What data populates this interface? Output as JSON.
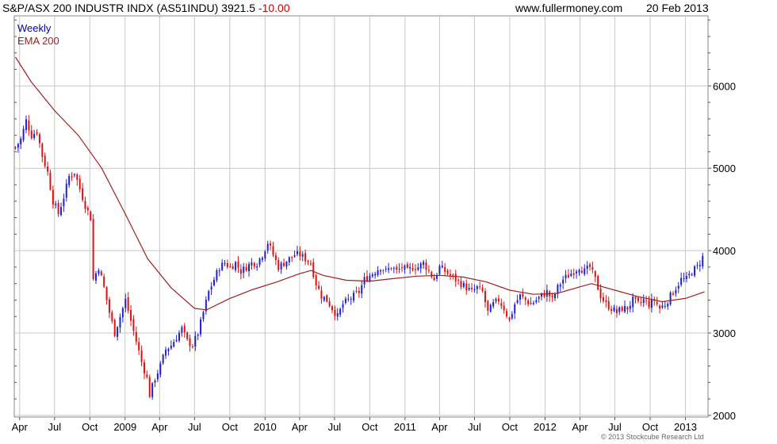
{
  "header": {
    "title_main": "S&P/ASX 200 INDUSTR INDX (AS51INDU) 3921.5",
    "title_change": "-10.00",
    "site": "www.fullermoney.com",
    "date": "20 Feb 2013"
  },
  "copyright": "© 2013 Stockcube Research Ltd",
  "colors": {
    "up": "#1f1fd6",
    "down": "#e01010",
    "ema": "#a02020",
    "grid": "#c8c8c8",
    "weekly_label": "#0000aa",
    "ema_label": "#a02020"
  },
  "chart_data": {
    "type": "candlestick",
    "title": "S&P/ASX 200 INDUSTR INDX (AS51INDU) 3921.5 -10.00",
    "legend": [
      "Weekly",
      "EMA 200"
    ],
    "legend_position": "top-left",
    "grid": true,
    "ylim": [
      1980,
      6850
    ],
    "yticks": [
      2000,
      3000,
      4000,
      5000,
      6000
    ],
    "xlim": [
      "2008-03-18",
      "2013-03-01"
    ],
    "xticks": [
      {
        "label": "Apr",
        "date": "2008-04-01"
      },
      {
        "label": "Jul",
        "date": "2008-07-01"
      },
      {
        "label": "Oct",
        "date": "2008-10-01"
      },
      {
        "label": "2009",
        "date": "2009-01-01"
      },
      {
        "label": "Apr",
        "date": "2009-04-01"
      },
      {
        "label": "Jul",
        "date": "2009-07-01"
      },
      {
        "label": "Oct",
        "date": "2009-10-01"
      },
      {
        "label": "2010",
        "date": "2010-01-01"
      },
      {
        "label": "Apr",
        "date": "2010-04-01"
      },
      {
        "label": "Jul",
        "date": "2010-07-01"
      },
      {
        "label": "Oct",
        "date": "2010-10-01"
      },
      {
        "label": "2011",
        "date": "2011-01-01"
      },
      {
        "label": "Apr",
        "date": "2011-04-01"
      },
      {
        "label": "Jul",
        "date": "2011-07-01"
      },
      {
        "label": "Oct",
        "date": "2011-10-01"
      },
      {
        "label": "2012",
        "date": "2012-01-01"
      },
      {
        "label": "Apr",
        "date": "2012-04-01"
      },
      {
        "label": "Jul",
        "date": "2012-07-01"
      },
      {
        "label": "Oct",
        "date": "2012-10-01"
      },
      {
        "label": "2013",
        "date": "2013-01-01"
      }
    ],
    "close_path": [
      [
        "2008-03-21",
        5250
      ],
      [
        "2008-04-04",
        5350
      ],
      [
        "2008-04-18",
        5580
      ],
      [
        "2008-05-02",
        5400
      ],
      [
        "2008-05-16",
        5450
      ],
      [
        "2008-05-30",
        5150
      ],
      [
        "2008-06-13",
        4950
      ],
      [
        "2008-06-27",
        4600
      ],
      [
        "2008-07-11",
        4450
      ],
      [
        "2008-07-25",
        4650
      ],
      [
        "2008-08-08",
        4900
      ],
      [
        "2008-08-22",
        4950
      ],
      [
        "2008-09-05",
        4750
      ],
      [
        "2008-09-19",
        4550
      ],
      [
        "2008-10-03",
        4400
      ],
      [
        "2008-10-10",
        3650
      ],
      [
        "2008-10-24",
        3800
      ],
      [
        "2008-11-07",
        3550
      ],
      [
        "2008-11-21",
        3250
      ],
      [
        "2008-12-05",
        3000
      ],
      [
        "2008-12-19",
        3200
      ],
      [
        "2009-01-02",
        3400
      ],
      [
        "2009-01-16",
        3150
      ],
      [
        "2009-01-30",
        2900
      ],
      [
        "2009-02-13",
        2650
      ],
      [
        "2009-02-27",
        2450
      ],
      [
        "2009-03-06",
        2250
      ],
      [
        "2009-03-20",
        2450
      ],
      [
        "2009-04-03",
        2600
      ],
      [
        "2009-04-17",
        2800
      ],
      [
        "2009-05-01",
        2850
      ],
      [
        "2009-05-15",
        2950
      ],
      [
        "2009-05-29",
        3050
      ],
      [
        "2009-06-12",
        2900
      ],
      [
        "2009-06-26",
        2850
      ],
      [
        "2009-07-10",
        3000
      ],
      [
        "2009-07-24",
        3250
      ],
      [
        "2009-08-07",
        3500
      ],
      [
        "2009-08-21",
        3650
      ],
      [
        "2009-09-04",
        3800
      ],
      [
        "2009-09-18",
        3850
      ],
      [
        "2009-10-02",
        3800
      ],
      [
        "2009-10-16",
        3850
      ],
      [
        "2009-10-30",
        3750
      ],
      [
        "2009-11-13",
        3800
      ],
      [
        "2009-11-27",
        3850
      ],
      [
        "2009-12-11",
        3850
      ],
      [
        "2009-12-25",
        3950
      ],
      [
        "2010-01-08",
        4100
      ],
      [
        "2010-01-22",
        3950
      ],
      [
        "2010-02-05",
        3800
      ],
      [
        "2010-02-19",
        3850
      ],
      [
        "2010-03-05",
        3900
      ],
      [
        "2010-03-19",
        3950
      ],
      [
        "2010-04-02",
        3950
      ],
      [
        "2010-04-16",
        3900
      ],
      [
        "2010-04-30",
        3850
      ],
      [
        "2010-05-14",
        3600
      ],
      [
        "2010-05-28",
        3450
      ],
      [
        "2010-06-11",
        3400
      ],
      [
        "2010-06-25",
        3300
      ],
      [
        "2010-07-09",
        3200
      ],
      [
        "2010-07-23",
        3350
      ],
      [
        "2010-08-06",
        3400
      ],
      [
        "2010-08-20",
        3450
      ],
      [
        "2010-09-03",
        3500
      ],
      [
        "2010-09-17",
        3650
      ],
      [
        "2010-10-01",
        3700
      ],
      [
        "2010-10-15",
        3750
      ],
      [
        "2010-10-29",
        3800
      ],
      [
        "2010-11-12",
        3750
      ],
      [
        "2010-11-26",
        3800
      ],
      [
        "2010-12-10",
        3750
      ],
      [
        "2010-12-24",
        3800
      ],
      [
        "2011-01-07",
        3750
      ],
      [
        "2011-01-21",
        3800
      ],
      [
        "2011-02-04",
        3800
      ],
      [
        "2011-02-18",
        3850
      ],
      [
        "2011-03-04",
        3750
      ],
      [
        "2011-03-18",
        3650
      ],
      [
        "2011-04-01",
        3800
      ],
      [
        "2011-04-15",
        3750
      ],
      [
        "2011-04-29",
        3700
      ],
      [
        "2011-05-13",
        3650
      ],
      [
        "2011-05-27",
        3600
      ],
      [
        "2011-06-10",
        3550
      ],
      [
        "2011-06-24",
        3500
      ],
      [
        "2011-07-08",
        3550
      ],
      [
        "2011-07-22",
        3500
      ],
      [
        "2011-08-05",
        3250
      ],
      [
        "2011-08-19",
        3350
      ],
      [
        "2011-09-02",
        3400
      ],
      [
        "2011-09-16",
        3300
      ],
      [
        "2011-09-30",
        3150
      ],
      [
        "2011-10-14",
        3350
      ],
      [
        "2011-10-28",
        3450
      ],
      [
        "2011-11-11",
        3400
      ],
      [
        "2011-11-25",
        3350
      ],
      [
        "2011-12-09",
        3400
      ],
      [
        "2011-12-23",
        3450
      ],
      [
        "2012-01-06",
        3500
      ],
      [
        "2012-01-20",
        3400
      ],
      [
        "2012-02-03",
        3550
      ],
      [
        "2012-02-17",
        3650
      ],
      [
        "2012-03-02",
        3700
      ],
      [
        "2012-03-16",
        3750
      ],
      [
        "2012-03-30",
        3800
      ],
      [
        "2012-04-13",
        3750
      ],
      [
        "2012-04-27",
        3800
      ],
      [
        "2012-05-11",
        3650
      ],
      [
        "2012-05-25",
        3450
      ],
      [
        "2012-06-08",
        3350
      ],
      [
        "2012-06-22",
        3300
      ],
      [
        "2012-07-06",
        3250
      ],
      [
        "2012-07-20",
        3300
      ],
      [
        "2012-08-03",
        3300
      ],
      [
        "2012-08-17",
        3400
      ],
      [
        "2012-08-31",
        3350
      ],
      [
        "2012-09-14",
        3400
      ],
      [
        "2012-09-28",
        3350
      ],
      [
        "2012-10-12",
        3400
      ],
      [
        "2012-10-26",
        3300
      ],
      [
        "2012-11-09",
        3350
      ],
      [
        "2012-11-23",
        3450
      ],
      [
        "2012-12-07",
        3550
      ],
      [
        "2012-12-21",
        3650
      ],
      [
        "2013-01-04",
        3650
      ],
      [
        "2013-01-18",
        3750
      ],
      [
        "2013-02-01",
        3800
      ],
      [
        "2013-02-15",
        3920
      ],
      [
        "2013-02-20",
        3921.5
      ]
    ],
    "ema_200": [
      [
        "2008-03-21",
        6350
      ],
      [
        "2008-05-01",
        6050
      ],
      [
        "2008-07-01",
        5700
      ],
      [
        "2008-09-01",
        5400
      ],
      [
        "2008-11-01",
        5000
      ],
      [
        "2009-01-01",
        4450
      ],
      [
        "2009-03-01",
        3900
      ],
      [
        "2009-05-01",
        3550
      ],
      [
        "2009-07-01",
        3300
      ],
      [
        "2009-08-01",
        3280
      ],
      [
        "2009-10-01",
        3420
      ],
      [
        "2009-12-01",
        3530
      ],
      [
        "2010-02-01",
        3620
      ],
      [
        "2010-04-01",
        3720
      ],
      [
        "2010-05-01",
        3760
      ],
      [
        "2010-06-01",
        3700
      ],
      [
        "2010-08-01",
        3640
      ],
      [
        "2010-10-01",
        3630
      ],
      [
        "2010-12-01",
        3660
      ],
      [
        "2011-02-01",
        3690
      ],
      [
        "2011-04-01",
        3700
      ],
      [
        "2011-06-01",
        3680
      ],
      [
        "2011-08-01",
        3620
      ],
      [
        "2011-10-01",
        3520
      ],
      [
        "2011-12-01",
        3470
      ],
      [
        "2012-02-01",
        3480
      ],
      [
        "2012-04-01",
        3560
      ],
      [
        "2012-05-01",
        3600
      ],
      [
        "2012-07-01",
        3520
      ],
      [
        "2012-09-01",
        3440
      ],
      [
        "2012-11-01",
        3380
      ],
      [
        "2013-01-01",
        3420
      ],
      [
        "2013-02-20",
        3500
      ]
    ]
  }
}
